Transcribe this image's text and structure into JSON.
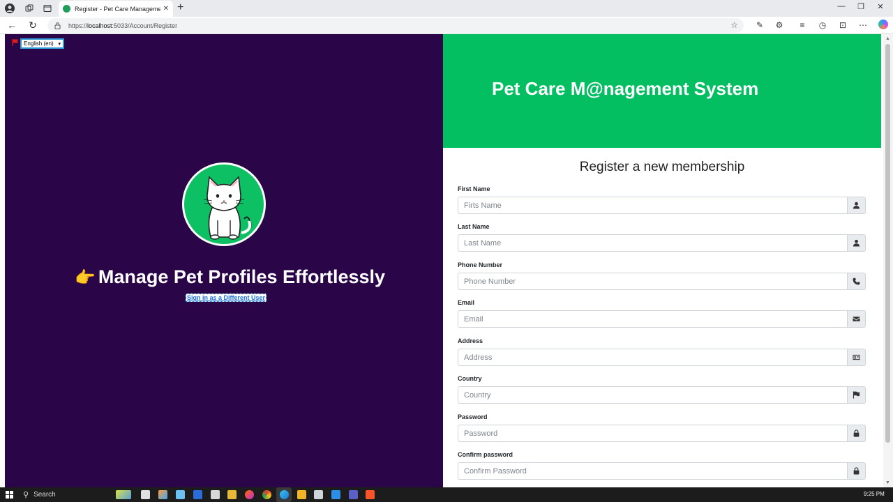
{
  "browser": {
    "tab_title": "Register - Pet Care Management",
    "tab_close": "✕",
    "new_tab": "+",
    "url_prefix": "https://",
    "url_host": "localhost",
    "url_rest": ":5033/Account/Register"
  },
  "page": {
    "language_selected": "English (en)",
    "headline": "Manage Pet Profiles Effortlessly",
    "headline_icon": "👉",
    "signin_link": "Sign in as a Different User",
    "banner_title": "Pet Care M@nagement System",
    "form_title": "Register a new membership"
  },
  "form": {
    "fields": [
      {
        "label": "First Name",
        "placeholder": "Firts Name",
        "icon": "user-icon"
      },
      {
        "label": "Last Name",
        "placeholder": "Last Name",
        "icon": "user-icon"
      },
      {
        "label": "Phone Number",
        "placeholder": "Phone Number",
        "icon": "phone-icon"
      },
      {
        "label": "Email",
        "placeholder": "Email",
        "icon": "envelope-icon"
      },
      {
        "label": "Address",
        "placeholder": "Address",
        "icon": "address-card-icon"
      },
      {
        "label": "Country",
        "placeholder": "Country",
        "icon": "flag-icon"
      },
      {
        "label": "Password",
        "placeholder": "Password",
        "icon": "lock-icon"
      },
      {
        "label": "Confirm password",
        "placeholder": "Confirm Password",
        "icon": "lock-icon"
      }
    ]
  },
  "taskbar": {
    "search_label": "Search",
    "clock": "9:25 PM"
  },
  "colors": {
    "left_pane": "#2a0648",
    "banner": "#03bf62",
    "avatar_bg": "#0cc063"
  }
}
